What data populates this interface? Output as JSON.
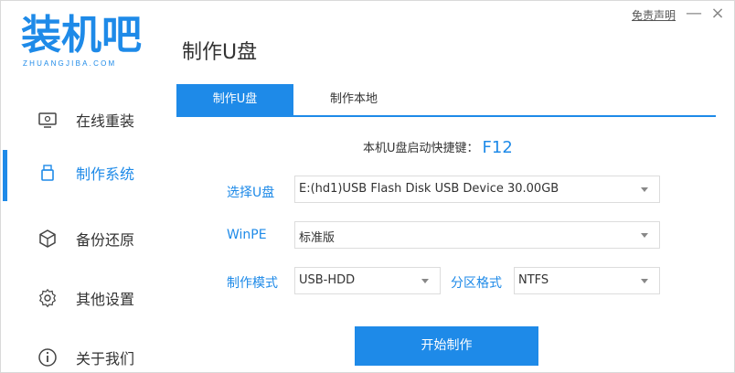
{
  "app": {
    "logo_text": "装机吧",
    "logo_subtext": "ZHUANGJIBA.COM",
    "page_title": "制作U盘",
    "disclaimer": "免责声明",
    "minimize": "—",
    "close": "×"
  },
  "sidebar": {
    "items": [
      {
        "label": "在线重装",
        "icon": "monitor-icon",
        "active": false
      },
      {
        "label": "制作系统",
        "icon": "usb-drive-icon",
        "active": true
      },
      {
        "label": "备份还原",
        "icon": "cube-icon",
        "active": false
      },
      {
        "label": "其他设置",
        "icon": "gear-icon",
        "active": false
      },
      {
        "label": "关于我们",
        "icon": "info-icon",
        "active": false
      }
    ]
  },
  "tabs": [
    {
      "label": "制作U盘",
      "active": true
    },
    {
      "label": "制作本地",
      "active": false
    }
  ],
  "form": {
    "hotkey_label": "本机U盘启动快捷键：",
    "hotkey_value": "F12",
    "usb_label": "选择U盘",
    "usb_value": "E:(hd1)USB Flash Disk USB Device 30.00GB",
    "winpe_label": "WinPE",
    "winpe_value": "标准版",
    "mode_label": "制作模式",
    "mode_value": "USB-HDD",
    "partition_label": "分区格式",
    "partition_value": "NTFS",
    "start_button": "开始制作"
  },
  "colors": {
    "accent": "#1e8ae8",
    "text": "#333333"
  }
}
